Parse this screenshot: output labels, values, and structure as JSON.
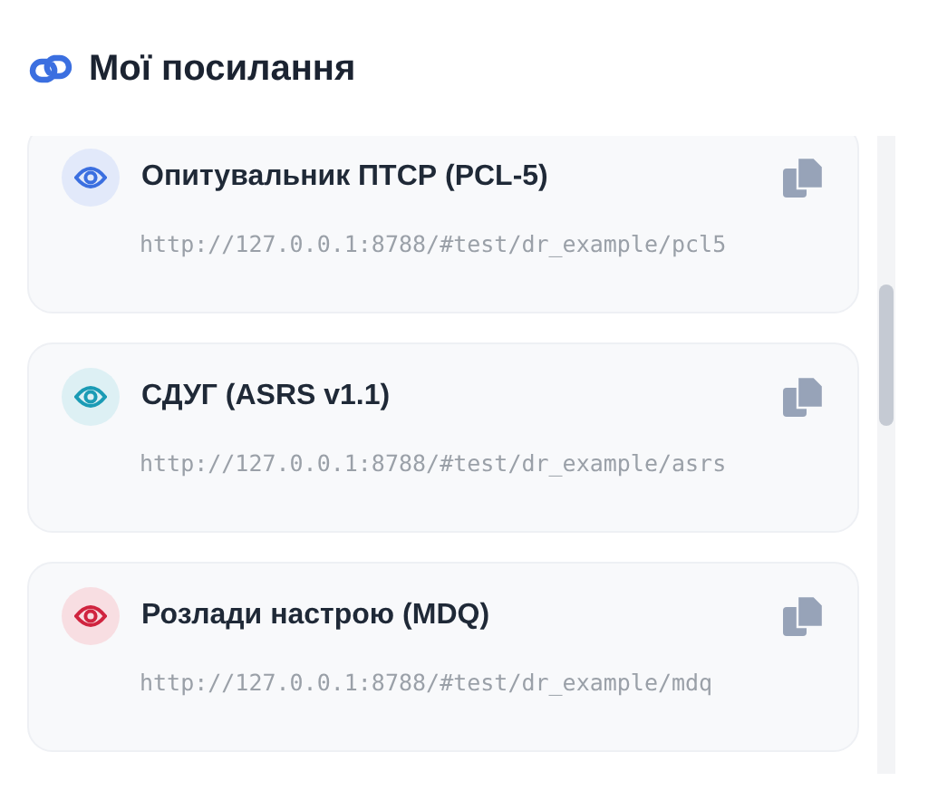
{
  "header": {
    "title": "Мої посилання"
  },
  "links": [
    {
      "title": "Опитувальник ПТСР (PCL-5)",
      "url": "http://127.0.0.1:8788/#test/dr_example/pcl5",
      "color": "#3b6fe0"
    },
    {
      "title": "СДУГ (ASRS v1.1)",
      "url": "http://127.0.0.1:8788/#test/dr_example/asrs",
      "color": "#1a9bb5"
    },
    {
      "title": "Розлади настрою (MDQ)",
      "url": "http://127.0.0.1:8788/#test/dr_example/mdq",
      "color": "#d0243f"
    }
  ]
}
